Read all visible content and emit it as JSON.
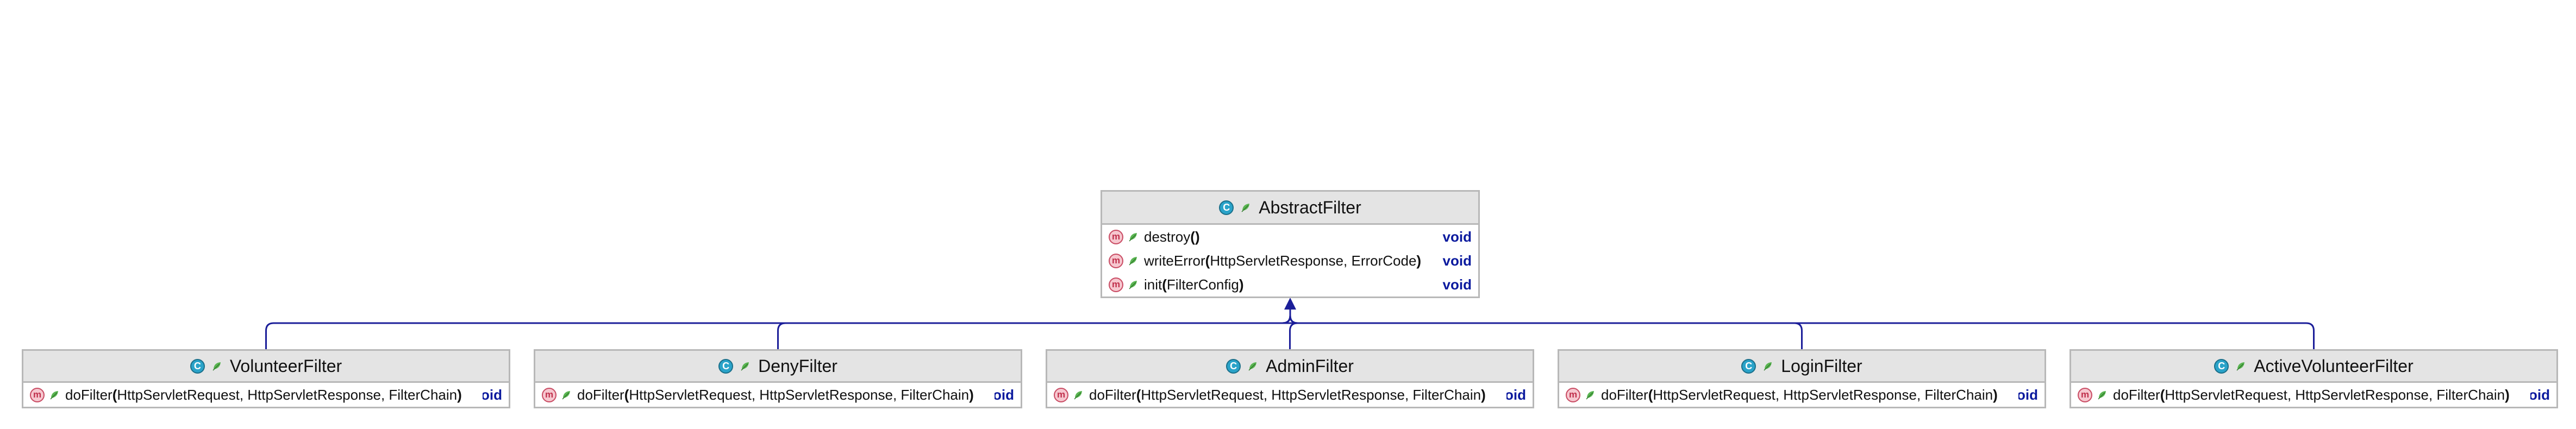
{
  "colors": {
    "edge": "#1b1e99",
    "header_bg": "#e4e4e4",
    "border": "#b8b8b8",
    "return_type": "#0b1a9e",
    "class_icon": "#2aa3c9",
    "method_icon": "#f6c7cf"
  },
  "diagram": {
    "parent": {
      "icon": "class-icon",
      "name": "AbstractFilter",
      "methods": [
        {
          "icon": "method-icon",
          "name": "destroy",
          "params": "",
          "return": "void"
        },
        {
          "icon": "method-icon",
          "name": "writeError",
          "params": "HttpServletResponse, ErrorCode",
          "return": "void"
        },
        {
          "icon": "method-icon",
          "name": "init",
          "params": "FilterConfig",
          "return": "void"
        }
      ]
    },
    "children": [
      {
        "icon": "class-icon",
        "name": "VolunteerFilter",
        "method": {
          "icon": "method-icon",
          "name": "doFilter",
          "params": "HttpServletRequest, HttpServletResponse, FilterChain",
          "return": "oid"
        }
      },
      {
        "icon": "class-icon",
        "name": "DenyFilter",
        "method": {
          "icon": "method-icon",
          "name": "doFilter",
          "params": "HttpServletRequest, HttpServletResponse, FilterChain",
          "return": "oid"
        }
      },
      {
        "icon": "class-icon",
        "name": "AdminFilter",
        "method": {
          "icon": "method-icon",
          "name": "doFilter",
          "params": "HttpServletRequest, HttpServletResponse, FilterChain",
          "return": "oid"
        }
      },
      {
        "icon": "class-icon",
        "name": "LoginFilter",
        "method": {
          "icon": "method-icon",
          "name": "doFilter",
          "params": "HttpServletRequest, HttpServletResponse, FilterChain",
          "return": "oid"
        }
      },
      {
        "icon": "class-icon",
        "name": "ActiveVolunteerFilter",
        "method": {
          "icon": "method-icon",
          "name": "doFilter",
          "params": "HttpServletRequest, HttpServletResponse, FilterChain",
          "return": "oid"
        }
      }
    ],
    "relation": "extends"
  }
}
